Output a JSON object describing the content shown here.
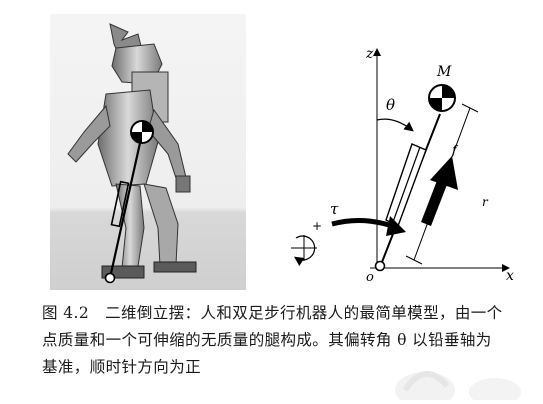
{
  "photo": {
    "description_icon": "biped-robot-photo"
  },
  "diagram": {
    "axis_z": "z",
    "axis_x": "x",
    "origin": "o",
    "mass": "M",
    "angle": "θ",
    "torque": "τ",
    "leg_force": "f",
    "leg_length": "r",
    "sign_plus": "+"
  },
  "caption": {
    "figure_number": "图 4.2",
    "line1": "二维倒立摆：人和双足步行机器人的最简单模型，由一个",
    "line2": "点质量和一个可伸缩的无质量的腿构成。其偏转角 θ 以铅垂轴为",
    "line3": "基准，顺时针方向为正"
  }
}
